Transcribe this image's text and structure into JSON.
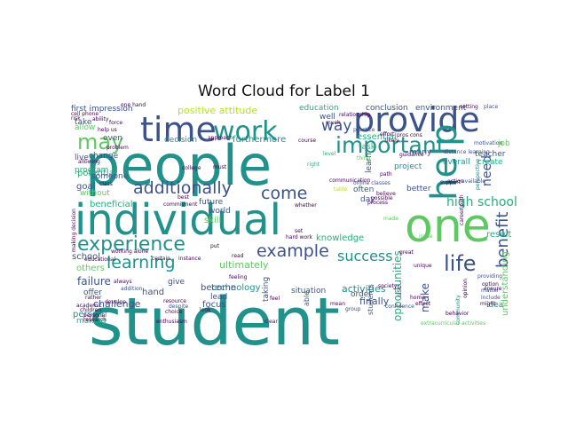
{
  "chart_data": {
    "type": "wordcloud",
    "title": "Word Cloud for Label 1",
    "background": "#ffffff",
    "palette": [
      "#440154",
      "#3b528b",
      "#21918c",
      "#27ad81",
      "#5ec962",
      "#b5de2b"
    ],
    "words": [
      {
        "text": "student",
        "weight": 100,
        "color": "#21918c"
      },
      {
        "text": "people",
        "weight": 82,
        "color": "#21918c"
      },
      {
        "text": "individual",
        "weight": 66,
        "color": "#21918c"
      },
      {
        "text": "one",
        "weight": 62,
        "color": "#5ec962"
      },
      {
        "text": "provide",
        "weight": 48,
        "color": "#3b528b"
      },
      {
        "text": "help",
        "weight": 44,
        "color": "#21918c"
      },
      {
        "text": "time",
        "weight": 42,
        "color": "#3b528b"
      },
      {
        "text": "work",
        "weight": 34,
        "color": "#21918c"
      },
      {
        "text": "important",
        "weight": 30,
        "color": "#21918c"
      },
      {
        "text": "experience",
        "weight": 28,
        "color": "#21918c"
      },
      {
        "text": "may",
        "weight": 27,
        "color": "#5ec962"
      },
      {
        "text": "life",
        "weight": 26,
        "color": "#3b528b"
      },
      {
        "text": "benefit",
        "weight": 25,
        "color": "#3b528b"
      },
      {
        "text": "learning",
        "weight": 22,
        "color": "#21918c"
      },
      {
        "text": "additionally",
        "weight": 22,
        "color": "#3b528b"
      },
      {
        "text": "example",
        "weight": 22,
        "color": "#3b528b"
      },
      {
        "text": "way",
        "weight": 21,
        "color": "#3b528b"
      },
      {
        "text": "come",
        "weight": 21,
        "color": "#3b528b"
      },
      {
        "text": "success",
        "weight": 19,
        "color": "#21918c"
      },
      {
        "text": "high school",
        "weight": 17,
        "color": "#27ad81"
      },
      {
        "text": "need",
        "weight": 16,
        "color": "#3b528b"
      },
      {
        "text": "opportunities",
        "weight": 15,
        "color": "#27ad81"
      },
      {
        "text": "positive attitude",
        "weight": 12,
        "color": "#b5de2b"
      },
      {
        "text": "failure",
        "weight": 12,
        "color": "#3b528b"
      },
      {
        "text": "make",
        "weight": 12,
        "color": "#3b528b"
      },
      {
        "text": "understanding",
        "weight": 11,
        "color": "#5ec962"
      },
      {
        "text": "activities",
        "weight": 11,
        "color": "#21918c"
      },
      {
        "text": "ultimately",
        "weight": 11,
        "color": "#5ec962"
      },
      {
        "text": "finally",
        "weight": 11,
        "color": "#3b528b"
      },
      {
        "text": "challenge",
        "weight": 11,
        "color": "#3b528b"
      },
      {
        "text": "beneficial",
        "weight": 11,
        "color": "#27ad81"
      },
      {
        "text": "essential",
        "weight": 10,
        "color": "#27ad81"
      },
      {
        "text": "technology",
        "weight": 10,
        "color": "#21918c"
      },
      {
        "text": "school",
        "weight": 10,
        "color": "#3b528b"
      },
      {
        "text": "others",
        "weight": 10,
        "color": "#5ec962"
      },
      {
        "text": "potential",
        "weight": 10,
        "color": "#27ad81"
      },
      {
        "text": "furthermore",
        "weight": 10,
        "color": "#21918c"
      },
      {
        "text": "person",
        "weight": 10,
        "color": "#21918c"
      },
      {
        "text": "skill",
        "weight": 10,
        "color": "#5ec962"
      },
      {
        "text": "hand",
        "weight": 10,
        "color": "#3b528b"
      },
      {
        "text": "goal",
        "weight": 10,
        "color": "#3b528b"
      },
      {
        "text": "knowledge",
        "weight": 10,
        "color": "#27ad81"
      },
      {
        "text": "result",
        "weight": 10,
        "color": "#27ad81"
      },
      {
        "text": "focus",
        "weight": 10,
        "color": "#3b528b"
      },
      {
        "text": "become",
        "weight": 10,
        "color": "#3b528b"
      },
      {
        "text": "first impression",
        "weight": 9,
        "color": "#3b528b"
      },
      {
        "text": "project",
        "weight": 9,
        "color": "#21918c"
      },
      {
        "text": "overall",
        "weight": 9,
        "color": "#21918c"
      },
      {
        "text": "teacher",
        "weight": 9,
        "color": "#3b528b"
      },
      {
        "text": "create",
        "weight": 9,
        "color": "#27ad81"
      },
      {
        "text": "task",
        "weight": 9,
        "color": "#27ad81"
      },
      {
        "text": "many",
        "weight": 9,
        "color": "#3b528b"
      },
      {
        "text": "learn",
        "weight": 9,
        "color": "#3b528b"
      },
      {
        "text": "better",
        "weight": 9,
        "color": "#3b528b"
      },
      {
        "text": "often",
        "weight": 9,
        "color": "#3b528b"
      },
      {
        "text": "order",
        "weight": 9,
        "color": "#3b528b"
      },
      {
        "text": "give",
        "weight": 9,
        "color": "#3b528b"
      },
      {
        "text": "lead",
        "weight": 9,
        "color": "#3b528b"
      },
      {
        "text": "world",
        "weight": 9,
        "color": "#3b528b"
      },
      {
        "text": "future",
        "weight": 9,
        "color": "#3b528b"
      },
      {
        "text": "situation",
        "weight": 9,
        "color": "#3b528b"
      },
      {
        "text": "taking",
        "weight": 9,
        "color": "#3b528b"
      },
      {
        "text": "decision",
        "weight": 9,
        "color": "#21918c"
      },
      {
        "text": "idea",
        "weight": 9,
        "color": "#21918c"
      },
      {
        "text": "offer",
        "weight": 9,
        "color": "#3b528b"
      },
      {
        "text": "making",
        "weight": 9,
        "color": "#27ad81"
      },
      {
        "text": "allow",
        "weight": 9,
        "color": "#5ec962"
      },
      {
        "text": "take",
        "weight": 9,
        "color": "#3b528b"
      },
      {
        "text": "even",
        "weight": 9,
        "color": "#3b528b"
      },
      {
        "text": "live",
        "weight": 9,
        "color": "#3b528b"
      },
      {
        "text": "change",
        "weight": 9,
        "color": "#3b528b"
      },
      {
        "text": "program",
        "weight": 9,
        "color": "#27ad81"
      },
      {
        "text": "someone",
        "weight": 9,
        "color": "#3b528b"
      },
      {
        "text": "without",
        "weight": 9,
        "color": "#5ec962"
      },
      {
        "text": "well",
        "weight": 9,
        "color": "#3b528b"
      },
      {
        "text": "education",
        "weight": 9,
        "color": "#27ad81"
      },
      {
        "text": "conclusion",
        "weight": 9,
        "color": "#3b528b"
      },
      {
        "text": "environment",
        "weight": 9,
        "color": "#3b528b"
      },
      {
        "text": "job",
        "weight": 9,
        "color": "#5ec962"
      },
      {
        "text": "day",
        "weight": 9,
        "color": "#3b528b"
      },
      {
        "text": "able",
        "weight": 8,
        "color": "#3b528b"
      },
      {
        "text": "students",
        "weight": 8,
        "color": "#3b528b"
      },
      {
        "text": "use",
        "weight": 8,
        "color": "#3b528b"
      },
      {
        "text": "thing",
        "weight": 5,
        "color": "#5ec962"
      },
      {
        "text": "distance learning",
        "weight": 6,
        "color": "#3b528b"
      },
      {
        "text": "online classes",
        "weight": 6,
        "color": "#3b528b"
      },
      {
        "text": "relationship",
        "weight": 5,
        "color": "#440154"
      },
      {
        "text": "motivation",
        "weight": 5,
        "color": "#3b528b"
      },
      {
        "text": "providing",
        "weight": 5,
        "color": "#3b528b"
      },
      {
        "text": "community",
        "weight": 5,
        "color": "#21918c"
      },
      {
        "text": "perspective",
        "weight": 5,
        "color": "#21918c"
      },
      {
        "text": "available",
        "weight": 5,
        "color": "#3b528b"
      },
      {
        "text": "support",
        "weight": 5,
        "color": "#440154"
      },
      {
        "text": "practice",
        "weight": 5,
        "color": "#3b528b"
      },
      {
        "text": "research",
        "weight": 5,
        "color": "#440154"
      },
      {
        "text": "personal",
        "weight": 5,
        "color": "#440154"
      },
      {
        "text": "commitment",
        "weight": 5,
        "color": "#440154"
      },
      {
        "text": "enthusiasm",
        "weight": 5,
        "color": "#440154"
      },
      {
        "text": "extracurricular activities",
        "weight": 5,
        "color": "#5ec962"
      },
      {
        "text": "certain",
        "weight": 5,
        "color": "#440154"
      },
      {
        "text": "instance",
        "weight": 5,
        "color": "#440154"
      },
      {
        "text": "hard work",
        "weight": 5,
        "color": "#440154"
      },
      {
        "text": "confidence",
        "weight": 5,
        "color": "#3b528b"
      },
      {
        "text": "behavior",
        "weight": 5,
        "color": "#440154"
      },
      {
        "text": "include",
        "weight": 5,
        "color": "#3b528b"
      },
      {
        "text": "ensure",
        "weight": 5,
        "color": "#440154"
      },
      {
        "text": "option",
        "weight": 5,
        "color": "#440154"
      },
      {
        "text": "matter",
        "weight": 5,
        "color": "#3b528b"
      },
      {
        "text": "home",
        "weight": 5,
        "color": "#440154"
      },
      {
        "text": "effect",
        "weight": 5,
        "color": "#440154"
      },
      {
        "text": "great",
        "weight": 5,
        "color": "#440154"
      },
      {
        "text": "unique",
        "weight": 5,
        "color": "#440154"
      },
      {
        "text": "group",
        "weight": 5,
        "color": "#3b528b"
      },
      {
        "text": "society",
        "weight": 5,
        "color": "#440154"
      },
      {
        "text": "mean",
        "weight": 5,
        "color": "#440154"
      },
      {
        "text": "clear",
        "weight": 5,
        "color": "#440154"
      },
      {
        "text": "choice",
        "weight": 5,
        "color": "#440154"
      },
      {
        "text": "resource",
        "weight": 5,
        "color": "#440154"
      },
      {
        "text": "develop",
        "weight": 5,
        "color": "#440154"
      },
      {
        "text": "always",
        "weight": 5,
        "color": "#440154"
      },
      {
        "text": "despite",
        "weight": 5,
        "color": "#3b528b"
      },
      {
        "text": "addition",
        "weight": 5,
        "color": "#3b528b"
      },
      {
        "text": "rather",
        "weight": 5,
        "color": "#440154"
      },
      {
        "text": "children",
        "weight": 5,
        "color": "#440154"
      },
      {
        "text": "academic",
        "weight": 5,
        "color": "#440154"
      },
      {
        "text": "educational",
        "weight": 5,
        "color": "#440154"
      },
      {
        "text": "working alone",
        "weight": 5,
        "color": "#440154"
      },
      {
        "text": "making decision",
        "weight": 5,
        "color": "#440154"
      },
      {
        "text": "cell phone",
        "weight": 5,
        "color": "#440154"
      },
      {
        "text": "risk",
        "weight": 5,
        "color": "#440154"
      },
      {
        "text": "one hand",
        "weight": 5,
        "color": "#440154"
      },
      {
        "text": "setting",
        "weight": 5,
        "color": "#440154"
      },
      {
        "text": "place",
        "weight": 5,
        "color": "#3b528b"
      },
      {
        "text": "ability",
        "weight": 5,
        "color": "#440154"
      },
      {
        "text": "force",
        "weight": 5,
        "color": "#440154"
      },
      {
        "text": "help us",
        "weight": 5,
        "color": "#440154"
      },
      {
        "text": "problem",
        "weight": 5,
        "color": "#440154"
      },
      {
        "text": "allowing",
        "weight": 5,
        "color": "#440154"
      },
      {
        "text": "class",
        "weight": 5,
        "color": "#440154"
      },
      {
        "text": "college",
        "weight": 5,
        "color": "#440154"
      },
      {
        "text": "must",
        "weight": 5,
        "color": "#440154"
      },
      {
        "text": "best",
        "weight": 5,
        "color": "#440154"
      },
      {
        "text": "put",
        "weight": 5,
        "color": "#440154"
      },
      {
        "text": "look",
        "weight": 5,
        "color": "#440154"
      },
      {
        "text": "feel",
        "weight": 5,
        "color": "#440154"
      },
      {
        "text": "right",
        "weight": 5,
        "color": "#27ad81"
      },
      {
        "text": "level",
        "weight": 5,
        "color": "#27ad81"
      },
      {
        "text": "course",
        "weight": 5,
        "color": "#440154"
      },
      {
        "text": "much",
        "weight": 5,
        "color": "#440154"
      },
      {
        "text": "whether",
        "weight": 5,
        "color": "#440154"
      },
      {
        "text": "communication",
        "weight": 5,
        "color": "#440154"
      },
      {
        "text": "believe",
        "weight": 5,
        "color": "#440154"
      },
      {
        "text": "possible",
        "weight": 5,
        "color": "#440154"
      },
      {
        "text": "process",
        "weight": 5,
        "color": "#440154"
      },
      {
        "text": "issue",
        "weight": 5,
        "color": "#5ec962"
      },
      {
        "text": "path",
        "weight": 5,
        "color": "#440154"
      },
      {
        "text": "action",
        "weight": 5,
        "color": "#440154"
      },
      {
        "text": "career path",
        "weight": 5,
        "color": "#440154"
      },
      {
        "text": "effort",
        "weight": 5,
        "color": "#440154"
      },
      {
        "text": "pros cons",
        "weight": 5,
        "color": "#440154"
      },
      {
        "text": "likely",
        "weight": 5,
        "color": "#440154"
      },
      {
        "text": "approach",
        "weight": 5,
        "color": "#440154"
      },
      {
        "text": "feeling",
        "weight": 5,
        "color": "#440154"
      },
      {
        "text": "opinion",
        "weight": 5,
        "color": "#440154"
      },
      {
        "text": "might",
        "weight": 5,
        "color": "#440154"
      },
      {
        "text": "made",
        "weight": 5,
        "color": "#5ec962"
      },
      {
        "text": "guidance",
        "weight": 5,
        "color": "#440154"
      },
      {
        "text": "table",
        "weight": 5,
        "color": "#b5de2b"
      },
      {
        "text": "set",
        "weight": 5,
        "color": "#440154"
      },
      {
        "text": "read",
        "weight": 5,
        "color": "#440154"
      }
    ]
  }
}
